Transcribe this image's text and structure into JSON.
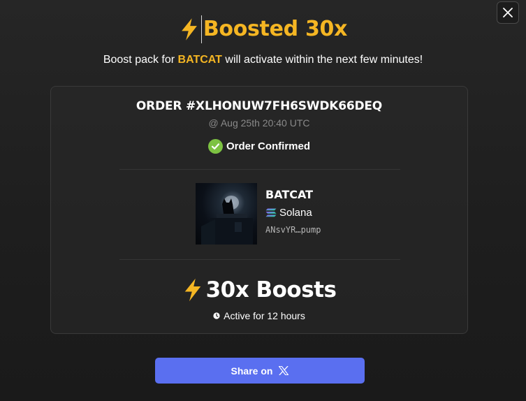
{
  "modal": {
    "title": "Boosted 30x",
    "subtitle_prefix": "Boost pack for ",
    "subtitle_token": "BATCAT",
    "subtitle_suffix": " will activate within the next few minutes!",
    "close_icon": "close-icon"
  },
  "order": {
    "id_label": "ORDER #XLHONUW7FH6SWDK66DEQ",
    "timestamp": "@ Aug 25th 20:40 UTC",
    "status": "Order Confirmed",
    "status_icon": "check-circle-icon"
  },
  "token": {
    "name": "BATCAT",
    "chain": "Solana",
    "chain_icon": "solana-icon",
    "address": "ANsvYR…pump",
    "image": "token-image"
  },
  "boost": {
    "amount_label": "30x Boosts",
    "icon": "lightning-icon",
    "duration": "Active for 12 hours",
    "duration_icon": "clock-icon"
  },
  "share": {
    "label": "Share on",
    "icon": "x-logo-icon",
    "color": "#5a6ff0"
  },
  "colors": {
    "accent": "#f5b623",
    "confirmed": "#7dc242",
    "background": "#1e1e1e"
  }
}
